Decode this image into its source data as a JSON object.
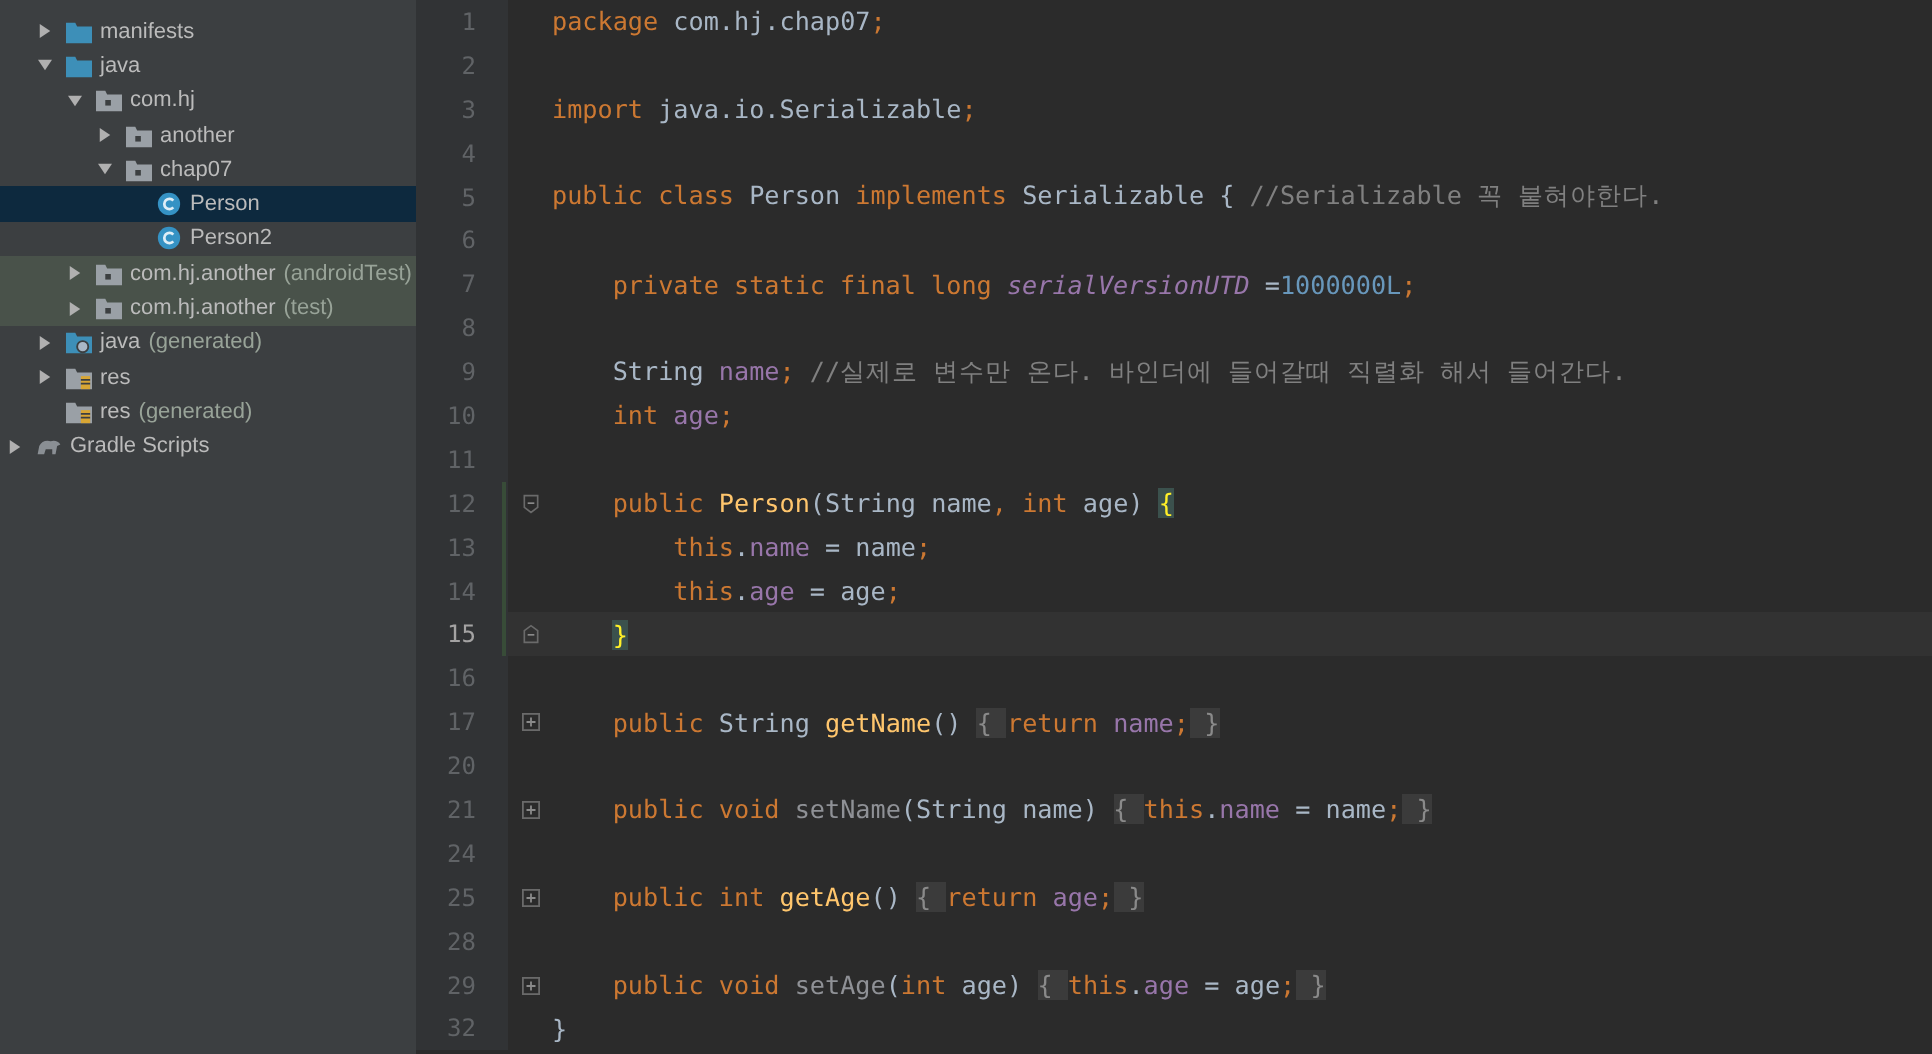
{
  "tree": [
    {
      "label": "manifests",
      "kind": "folder",
      "expanded": false,
      "selected": false,
      "test": false
    },
    {
      "label": "java",
      "kind": "folder",
      "expanded": true,
      "selected": false,
      "test": false,
      "children": [
        {
          "label": "com.hj",
          "kind": "package",
          "expanded": true,
          "selected": false,
          "test": false,
          "children": [
            {
              "label": "another",
              "kind": "package",
              "expanded": false,
              "selected": false,
              "test": false
            },
            {
              "label": "chap07",
              "kind": "package",
              "expanded": true,
              "selected": false,
              "test": false,
              "children": [
                {
                  "label": "Person",
                  "kind": "class",
                  "selected": true,
                  "test": false
                },
                {
                  "label": "Person2",
                  "kind": "class",
                  "selected": false,
                  "test": false
                }
              ]
            }
          ]
        },
        {
          "label": "com.hj.another",
          "suffix": "(androidTest)",
          "kind": "package",
          "expanded": false,
          "selected": false,
          "test": true
        },
        {
          "label": "com.hj.another",
          "suffix": "(test)",
          "kind": "package",
          "expanded": false,
          "selected": false,
          "test": true
        }
      ]
    },
    {
      "label": "java",
      "suffix": "(generated)",
      "kind": "generated",
      "expanded": false,
      "selected": false,
      "test": false
    },
    {
      "label": "res",
      "kind": "res",
      "expanded": false,
      "selected": false,
      "test": false
    },
    {
      "label": "res",
      "suffix": "(generated)",
      "kind": "res",
      "selected": false,
      "test": false
    }
  ],
  "root_items": [
    {
      "label": "Gradle Scripts",
      "kind": "gradle",
      "expanded": false,
      "selected": false
    }
  ],
  "editor": {
    "lines": [
      {
        "number": "1",
        "kind": "plain",
        "current": false,
        "changed": false,
        "tokens": [
          {
            "kind": "kw",
            "text": "package "
          },
          {
            "kind": "text",
            "text": "com.hj.chap07"
          },
          {
            "kind": "kw",
            "text": ";"
          }
        ]
      },
      {
        "number": "2",
        "kind": "plain",
        "current": false,
        "changed": false
      },
      {
        "number": "3",
        "kind": "plain",
        "current": false,
        "changed": false,
        "tokens": [
          {
            "kind": "kw",
            "text": "import "
          },
          {
            "kind": "text",
            "text": "java.io.Serializable"
          },
          {
            "kind": "kw",
            "text": ";"
          }
        ]
      },
      {
        "number": "4",
        "kind": "plain",
        "current": false,
        "changed": false
      },
      {
        "number": "5",
        "kind": "plain",
        "current": false,
        "changed": false,
        "tokens": [
          {
            "kind": "kw",
            "text": "public class "
          },
          {
            "kind": "text",
            "text": "Person "
          },
          {
            "kind": "kw",
            "text": "implements "
          },
          {
            "kind": "text",
            "text": "Serializable { "
          },
          {
            "kind": "comment",
            "text": "//Serializable 꼭 붙혀야한다."
          }
        ]
      },
      {
        "number": "6",
        "kind": "plain",
        "current": false,
        "changed": false
      },
      {
        "number": "7",
        "kind": "plain",
        "current": false,
        "changed": false,
        "tokens": [
          {
            "kind": "kw",
            "text": "    private static final long "
          },
          {
            "kind": "static",
            "text": "serialVersionUTD"
          },
          {
            "kind": "text",
            "text": " ="
          },
          {
            "kind": "num",
            "text": "1000000L"
          },
          {
            "kind": "kw",
            "text": ";"
          }
        ]
      },
      {
        "number": "8",
        "kind": "plain",
        "current": false,
        "changed": false
      },
      {
        "number": "9",
        "kind": "plain",
        "current": false,
        "changed": false,
        "tokens": [
          {
            "kind": "text",
            "text": "    String "
          },
          {
            "kind": "field",
            "text": "name"
          },
          {
            "kind": "kw",
            "text": ";"
          },
          {
            "kind": "comment",
            "text": " //실제로 변수만 온다. 바인더에 들어갈때 직렬화 해서 들어간다."
          }
        ]
      },
      {
        "number": "10",
        "kind": "plain",
        "current": false,
        "changed": false,
        "tokens": [
          {
            "kind": "kw",
            "text": "    int "
          },
          {
            "kind": "field",
            "text": "age"
          },
          {
            "kind": "kw",
            "text": ";"
          }
        ]
      },
      {
        "number": "11",
        "kind": "plain",
        "current": false,
        "changed": false
      },
      {
        "number": "12",
        "kind": "fold-open",
        "current": false,
        "changed": true,
        "tokens": [
          {
            "kind": "kw",
            "text": "    public "
          },
          {
            "kind": "method",
            "text": "Person"
          },
          {
            "kind": "text",
            "text": "(String name"
          },
          {
            "kind": "kw",
            "text": ", int "
          },
          {
            "kind": "text",
            "text": "age) "
          },
          {
            "kind": "match",
            "text": "{"
          }
        ]
      },
      {
        "number": "13",
        "kind": "plain",
        "current": false,
        "changed": true,
        "tokens": [
          {
            "kind": "kw",
            "text": "        this"
          },
          {
            "kind": "text",
            "text": "."
          },
          {
            "kind": "field",
            "text": "name"
          },
          {
            "kind": "text",
            "text": " = name"
          },
          {
            "kind": "kw",
            "text": ";"
          }
        ]
      },
      {
        "number": "14",
        "kind": "plain",
        "current": false,
        "changed": true,
        "tokens": [
          {
            "kind": "kw",
            "text": "        this"
          },
          {
            "kind": "text",
            "text": "."
          },
          {
            "kind": "field",
            "text": "age"
          },
          {
            "kind": "text",
            "text": " = age"
          },
          {
            "kind": "kw",
            "text": ";"
          }
        ]
      },
      {
        "number": "15",
        "kind": "fold-close",
        "current": true,
        "changed": true,
        "tokens": [
          {
            "kind": "match",
            "text": "    }"
          }
        ]
      },
      {
        "number": "16",
        "kind": "plain",
        "current": false,
        "changed": false
      },
      {
        "number": "17",
        "kind": "folded",
        "current": false,
        "changed": false,
        "tokens": [
          {
            "kind": "kw",
            "text": "    public "
          },
          {
            "kind": "text",
            "text": "String "
          },
          {
            "kind": "method",
            "text": "getName"
          },
          {
            "kind": "text",
            "text": "() "
          },
          {
            "kind": "fold",
            "text": "{ "
          },
          {
            "kind": "kw",
            "text": "return "
          },
          {
            "kind": "field",
            "text": "name"
          },
          {
            "kind": "kw",
            "text": ";"
          },
          {
            "kind": "fold",
            "text": " }"
          }
        ]
      },
      {
        "number": "20",
        "kind": "plain",
        "current": false,
        "changed": false
      },
      {
        "number": "21",
        "kind": "folded",
        "current": false,
        "changed": false,
        "tokens": [
          {
            "kind": "kw",
            "text": "    public void "
          },
          {
            "kind": "unused",
            "text": "setName"
          },
          {
            "kind": "text",
            "text": "(String name) "
          },
          {
            "kind": "fold",
            "text": "{ "
          },
          {
            "kind": "kw",
            "text": "this"
          },
          {
            "kind": "text",
            "text": "."
          },
          {
            "kind": "field",
            "text": "name"
          },
          {
            "kind": "text",
            "text": " = name"
          },
          {
            "kind": "kw",
            "text": ";"
          },
          {
            "kind": "fold",
            "text": " }"
          }
        ]
      },
      {
        "number": "24",
        "kind": "plain",
        "current": false,
        "changed": false
      },
      {
        "number": "25",
        "kind": "folded",
        "current": false,
        "changed": false,
        "tokens": [
          {
            "kind": "kw",
            "text": "    public int "
          },
          {
            "kind": "method",
            "text": "getAge"
          },
          {
            "kind": "text",
            "text": "() "
          },
          {
            "kind": "fold",
            "text": "{ "
          },
          {
            "kind": "kw",
            "text": "return "
          },
          {
            "kind": "field",
            "text": "age"
          },
          {
            "kind": "kw",
            "text": ";"
          },
          {
            "kind": "fold",
            "text": " }"
          }
        ]
      },
      {
        "number": "28",
        "kind": "plain",
        "current": false,
        "changed": false
      },
      {
        "number": "29",
        "kind": "folded",
        "current": false,
        "changed": false,
        "tokens": [
          {
            "kind": "kw",
            "text": "    public void "
          },
          {
            "kind": "unused",
            "text": "setAge"
          },
          {
            "kind": "text",
            "text": "("
          },
          {
            "kind": "kw",
            "text": "int "
          },
          {
            "kind": "text",
            "text": "age) "
          },
          {
            "kind": "fold",
            "text": "{ "
          },
          {
            "kind": "kw",
            "text": "this"
          },
          {
            "kind": "text",
            "text": "."
          },
          {
            "kind": "field",
            "text": "age"
          },
          {
            "kind": "text",
            "text": " = age"
          },
          {
            "kind": "kw",
            "text": ";"
          },
          {
            "kind": "fold",
            "text": " }"
          }
        ]
      },
      {
        "number": "32",
        "kind": "plain",
        "current": false,
        "changed": false,
        "tokens": [
          {
            "kind": "text",
            "text": "}"
          }
        ]
      }
    ]
  }
}
